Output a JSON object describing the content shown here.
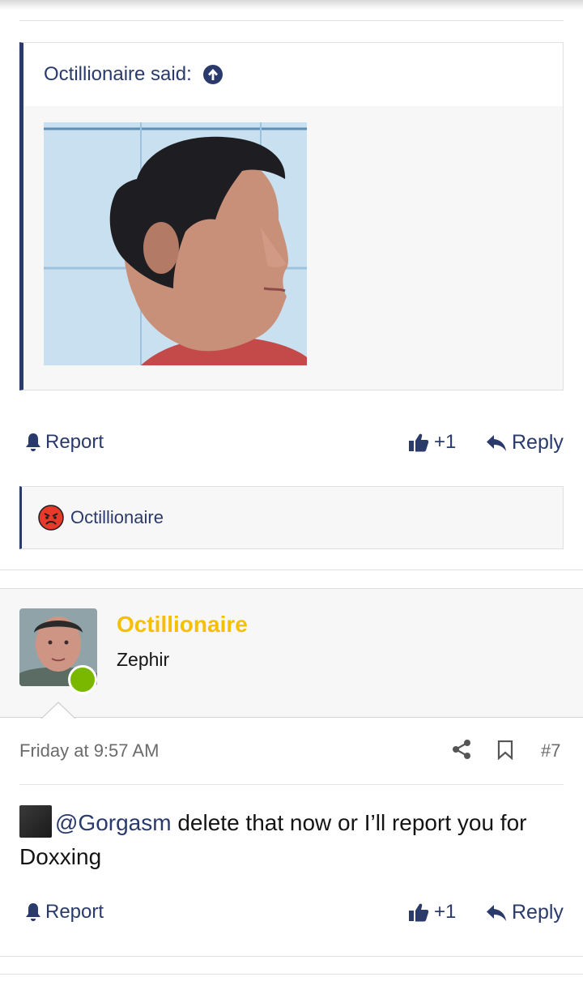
{
  "quote": {
    "author_label": "Octillionaire said:",
    "image_alt": "profile photo"
  },
  "actions_1": {
    "report": "Report",
    "like_count": "+1",
    "reply": "Reply"
  },
  "reaction": {
    "name": "Octillionaire"
  },
  "post": {
    "username": "Octillionaire",
    "user_title": "Zephir",
    "date": "Friday at 9:57 AM",
    "number": "#7",
    "mention": "@Gorgasm",
    "text": " delete that now or I’ll report you for Doxxing"
  },
  "actions_2": {
    "report": "Report",
    "like_count": "+1",
    "reply": "Reply"
  },
  "colors": {
    "link": "#2a3a6b",
    "username": "#f6c000",
    "online": "#7ab800",
    "reaction": "#e8392b"
  }
}
